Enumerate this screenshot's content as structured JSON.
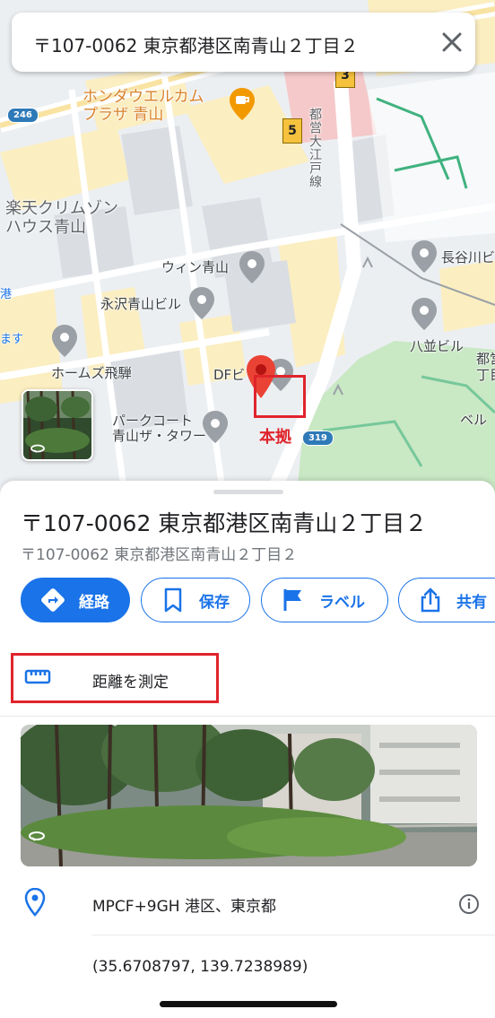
{
  "search": {
    "query": "〒107-0062 東京都港区南青山２丁目２"
  },
  "map": {
    "labels": {
      "honda": "ホンダウエルカム\nプラザ 青山",
      "rakuten": "楽天クリムゾン\nハウス青山",
      "win": "ウィン青山",
      "nagasawa": "永沢青山ビル",
      "homes": "ホームズ飛騨",
      "df": "DFビ",
      "parkcourt": "パークコート\n青山ザ・タワー",
      "hasegawa": "長谷川ビ",
      "yanami": "八並ビル",
      "toei_vertical": "都営大江戸線",
      "toei_right": "都営",
      "chome": "丁目",
      "bell": "ベル",
      "left_edge_1": "港",
      "left_edge_2": "ます"
    },
    "route_badges": [
      "3",
      "5"
    ],
    "road_shields": [
      "246",
      "319"
    ],
    "annotation": "本拠"
  },
  "sheet": {
    "title": "〒107-0062 東京都港区南青山２丁目２",
    "subtitle": "〒107-0062 東京都港区南青山２丁目２",
    "actions": {
      "route": "経路",
      "save": "保存",
      "label": "ラベル",
      "share": "共有"
    },
    "measure": "距離を測定",
    "plus_code": "MPCF+9GH 港区、東京都",
    "coordinates": "(35.6708797, 139.7238989)"
  },
  "colors": {
    "accent": "#1a73e8",
    "annotation": "#e0242b",
    "park": "#c9e8c4",
    "building": "#fbeec1"
  }
}
